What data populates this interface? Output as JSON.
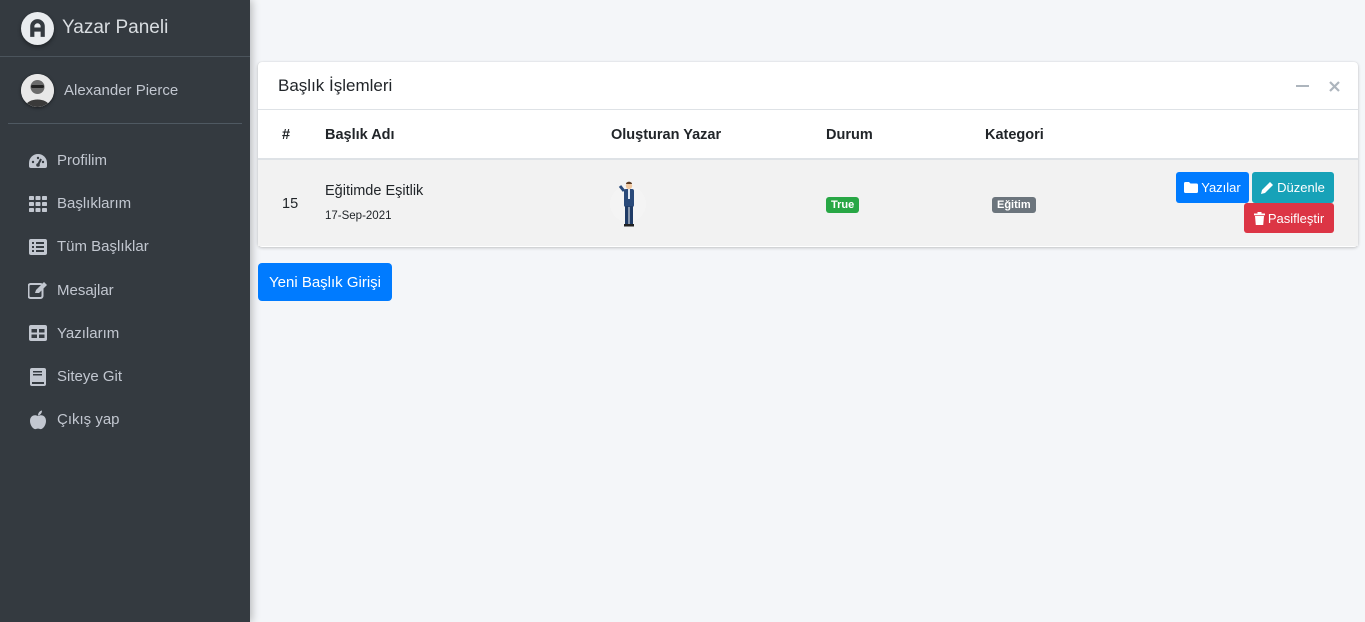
{
  "sidebar": {
    "brand": {
      "title": "Yazar Paneli",
      "icon": "brand-logo-icon"
    },
    "user": {
      "name": "Alexander Pierce"
    },
    "items": [
      {
        "label": "Profilim",
        "icon": "tachometer-icon"
      },
      {
        "label": "Başlıklarım",
        "icon": "grid-icon"
      },
      {
        "label": "Tüm Başlıklar",
        "icon": "list-icon"
      },
      {
        "label": "Mesajlar",
        "icon": "edit-icon"
      },
      {
        "label": "Yazılarım",
        "icon": "table-icon"
      },
      {
        "label": "Siteye Git",
        "icon": "book-icon"
      },
      {
        "label": "Çıkış yap",
        "icon": "apple-icon"
      }
    ]
  },
  "card": {
    "title": "Başlık İşlemleri",
    "columns": [
      "#",
      "Başlık Adı",
      "Oluşturan Yazar",
      "Durum",
      "Kategori"
    ],
    "rows": [
      {
        "id": "15",
        "title": "Eğitimde Eşitlik",
        "date": "17-Sep-2021",
        "status": "True",
        "category": "Eğitim",
        "actions": {
          "posts": "Yazılar",
          "edit": "Düzenle",
          "deactivate": "Pasifleştir"
        }
      }
    ]
  },
  "new_button": "Yeni Başlık Girişi",
  "colors": {
    "sidebar": "#343a40",
    "primary": "#007bff",
    "info": "#17a2b8",
    "danger": "#dc3545",
    "success": "#28a745",
    "secondary": "#6c757d",
    "background": "#f4f6f9"
  }
}
